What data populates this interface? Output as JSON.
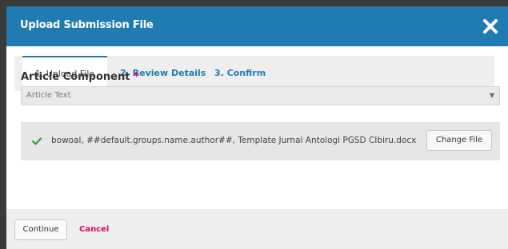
{
  "modal": {
    "title": "Upload Submission File"
  },
  "tabs": [
    {
      "label": "1. Upload File",
      "active": true
    },
    {
      "label": "2. Review Details",
      "active": false
    },
    {
      "label": "3. Confirm",
      "active": false
    }
  ],
  "article_component": {
    "label": "Article Component",
    "required_mark": "*",
    "selected": "Article Text"
  },
  "file": {
    "name": "bowoal, ##default.groups.name.author##, Template Jurnal Antologi PGSD CIbiru.docx",
    "change_label": "Change File"
  },
  "footer": {
    "continue_label": "Continue",
    "cancel_label": "Cancel"
  },
  "colors": {
    "header": "#1f7bb1",
    "accent_link": "#1f7bb1",
    "required": "#d00a6c",
    "check": "#2e9b3a"
  },
  "icons": {
    "close": "close-icon",
    "check": "check-icon",
    "dropdown": "chevron-down-icon"
  }
}
